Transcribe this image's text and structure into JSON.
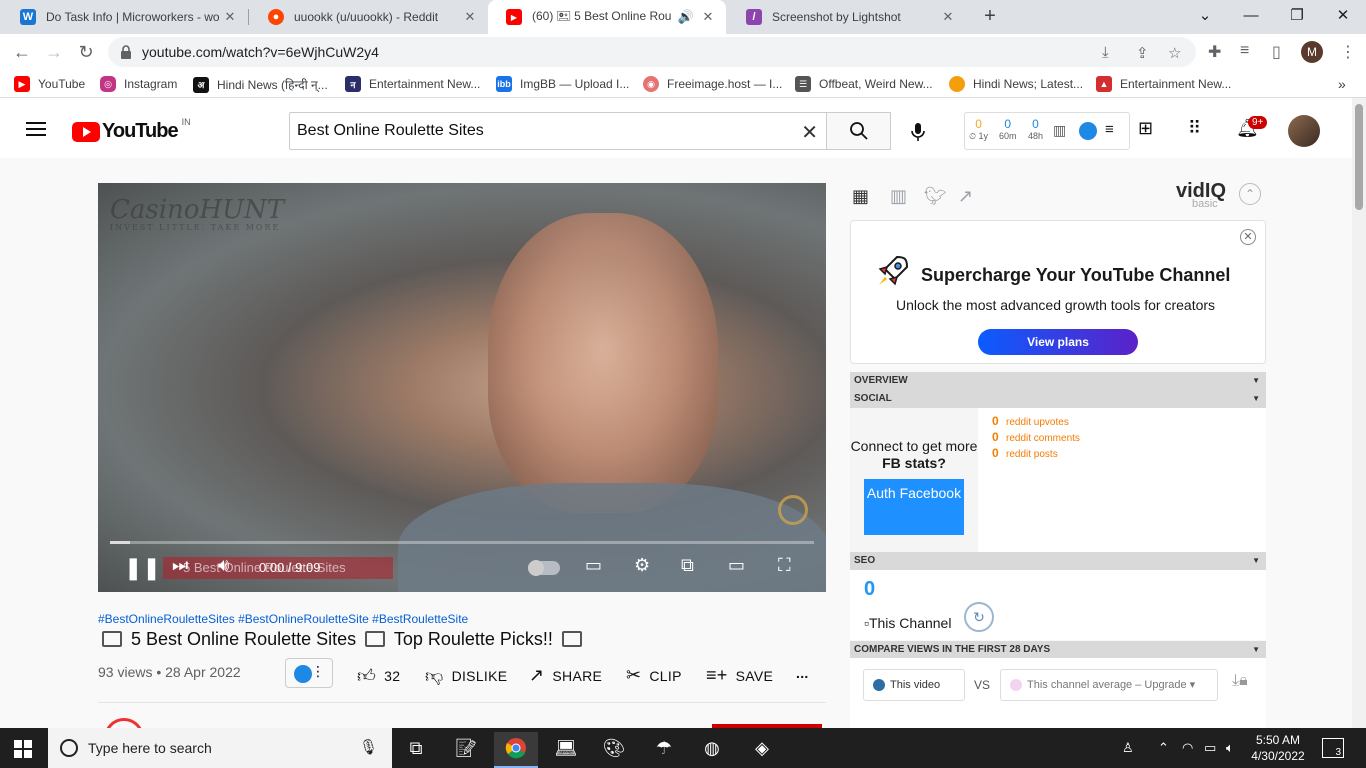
{
  "browser": {
    "tabs": [
      {
        "title": "Do Task Info | Microworkers - wo",
        "favicon_letter": "W",
        "favicon_color": "#1976d2"
      },
      {
        "title": "uuookk (u/uuookk) - Reddit",
        "favicon_letter": "●",
        "favicon_color": "#ff4500"
      },
      {
        "title": "(60) 🖭 5 Best Online Roulet",
        "favicon_letter": "▶",
        "favicon_color": "#ff0000",
        "active": true
      },
      {
        "title": "Screenshot by Lightshot",
        "favicon_letter": "/",
        "favicon_color": "#8e44ad"
      }
    ],
    "url": "youtube.com/watch?v=6eWjhCuW2y4",
    "bookmarks": [
      {
        "label": "YouTube",
        "color": "#ff0000"
      },
      {
        "label": "Instagram",
        "color": "#c13584"
      },
      {
        "label": "Hindi News (हिन्दी न्...",
        "color": "#111111"
      },
      {
        "label": "Entertainment New...",
        "color": "#2d2d6b"
      },
      {
        "label": "ImgBB — Upload I...",
        "color": "#1a73e8"
      },
      {
        "label": "Freeimage.host — I...",
        "color": "#e57373"
      },
      {
        "label": "Offbeat, Weird New...",
        "color": "#555555"
      },
      {
        "label": "Hindi News; Latest...",
        "color": "#f59e0b"
      },
      {
        "label": "Entertainment New...",
        "color": "#d32f2f"
      }
    ],
    "bookmarks_more": "»",
    "profile_letter": "M"
  },
  "youtube": {
    "logo_text": "YouTube",
    "country_code": "IN",
    "search_value": "Best Online Roulette Sites",
    "vidiq_stats": [
      {
        "value": "0",
        "label": "1y"
      },
      {
        "value": "0",
        "label": "60m"
      },
      {
        "value": "0",
        "label": "48h"
      }
    ],
    "notification_count": "9+"
  },
  "player": {
    "brand_text": "CasinoHUNT",
    "brand_tagline": "INVEST LITTLE. TAKE MORE",
    "overlay_text": "5 Best Online Roulette Sites",
    "time": "0:00 / 9:09",
    "progress_fraction": 0.028
  },
  "video": {
    "hashtags": "#BestOnlineRouletteSites #BestOnlineRouletteSite #BestRouletteSite",
    "title": "5 Best Online Roulette Sites",
    "title_suffix": "Top Roulette Picks!!",
    "meta": "93 views • 28 Apr 2022",
    "like_count": "32",
    "dislike_label": "DISLIKE",
    "share_label": "SHARE",
    "clip_label": "CLIP",
    "save_label": "SAVE",
    "more_label": "..."
  },
  "vidiq": {
    "logo": "vidIQ",
    "logo_sub": "basic",
    "promo_title": "Supercharge Your YouTube Channel",
    "promo_sub": "Unlock the most advanced growth tools for creators",
    "promo_button": "View plans",
    "sections": {
      "overview": "OVERVIEW",
      "social": "SOCIAL",
      "seo": "SEO",
      "compare": "COMPARE VIEWS IN THE FIRST 28 DAYS"
    },
    "social_connect": "Connect to get more",
    "social_fb": "FB",
    "social_stats_word": "stats?",
    "auth_button": "Auth Facebook",
    "social_stats": [
      {
        "value": "0",
        "label": "reddit upvotes"
      },
      {
        "value": "0",
        "label": "reddit comments"
      },
      {
        "value": "0",
        "label": "reddit posts"
      }
    ],
    "seo_score": "0",
    "seo_channel_alt": "This Channel",
    "compare_this": "This video",
    "compare_vs": "VS",
    "compare_other": "This channel average  –  Upgrade"
  },
  "taskbar": {
    "search_placeholder": "Type here to search",
    "time": "5:50 AM",
    "date": "4/30/2022",
    "notification_count": "3"
  }
}
